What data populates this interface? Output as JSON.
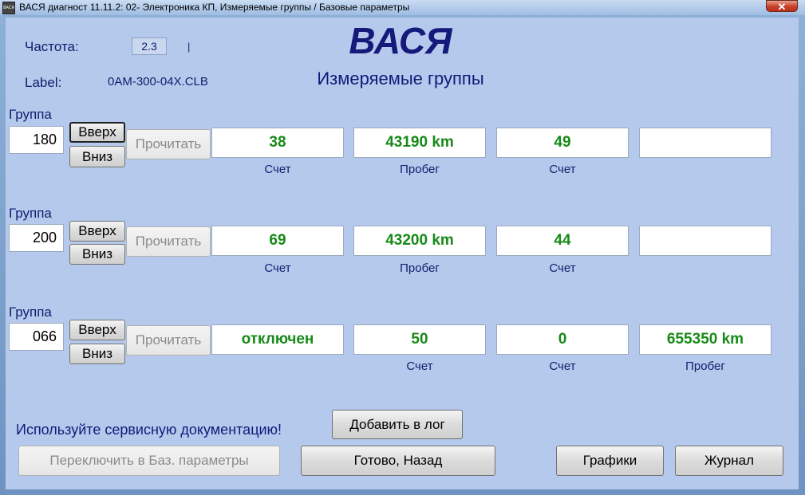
{
  "window": {
    "app_icon": "ВАСЯ",
    "title": "ВАСЯ диагност 11.11.2: 02- Электроника КП,  Измеряемые группы / Базовые параметры",
    "close": "✕"
  },
  "header": {
    "freq_label": "Частота:",
    "freq_value": "2.3",
    "freq_mark": "|",
    "label_label": "Label:",
    "label_value": "0AM-300-04X.CLB",
    "logo": "ВАСЯ",
    "subtitle": "Измеряемые группы"
  },
  "groups": [
    {
      "label": "Группа",
      "number": "180",
      "up": "Вверх",
      "down": "Вниз",
      "read": "Прочитать",
      "fields": [
        {
          "value": "38",
          "unit": "Счет"
        },
        {
          "value": "43190 km",
          "unit": "Пробег"
        },
        {
          "value": "49",
          "unit": "Счет"
        },
        {
          "value": "",
          "unit": ""
        }
      ]
    },
    {
      "label": "Группа",
      "number": "200",
      "up": "Вверх",
      "down": "Вниз",
      "read": "Прочитать",
      "fields": [
        {
          "value": "69",
          "unit": "Счет"
        },
        {
          "value": "43200 km",
          "unit": "Пробег"
        },
        {
          "value": "44",
          "unit": "Счет"
        },
        {
          "value": "",
          "unit": ""
        }
      ]
    },
    {
      "label": "Группа",
      "number": "066",
      "up": "Вверх",
      "down": "Вниз",
      "read": "Прочитать",
      "fields": [
        {
          "value": "отключен",
          "unit": ""
        },
        {
          "value": "50",
          "unit": "Счет"
        },
        {
          "value": "0",
          "unit": "Счет"
        },
        {
          "value": "655350 km",
          "unit": "Пробег"
        }
      ]
    }
  ],
  "footer": {
    "hint": "Используйте сервисную документацию!",
    "add_log": "Добавить в лог",
    "switch_basic": "Переключить в Баз. параметры",
    "done_back": "Готово, Назад",
    "graphs": "Графики",
    "journal": "Журнал"
  },
  "colors": {
    "value_text": "#178a17",
    "label_text": "#0f1f6e",
    "client_bg": "#b4c9eb"
  }
}
